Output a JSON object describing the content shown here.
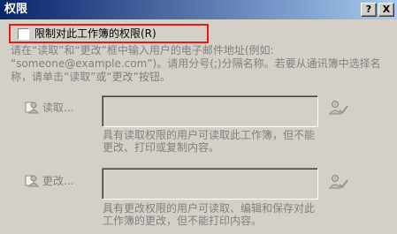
{
  "window": {
    "title": "权限",
    "help_label": "?",
    "close_label": "X"
  },
  "restrict": {
    "checkbox_label": "限制对此工作簿的权限(R)",
    "checked": false
  },
  "instructions": {
    "lines": [
      "请在“读取”和“更改”框中输入用户的电子邮件地址(例如:",
      "“someone@example.com”)。请用分号(;)分隔名称。若要从通讯簿中选择名",
      "称，请单击“读取”或“更改”按钮。"
    ]
  },
  "read": {
    "button_label": "读取...",
    "input_value": "",
    "description_lines": [
      "具有读取权限的用户可读取此工作簿，但不能",
      "更改、打印或复制内容。"
    ],
    "check_icon": "check-names-icon"
  },
  "change": {
    "button_label": "更改...",
    "input_value": "",
    "description_lines": [
      "具有更改权限的用户可读取、编辑和保存对此",
      "工作簿的更改，但不能打印内容。"
    ],
    "check_icon": "check-names-icon"
  },
  "colors": {
    "title_gradient_start": "#0a246a",
    "title_gradient_end": "#a6caf0",
    "highlight_border": "#e8171c",
    "dialog_face": "#d4d0c8",
    "disabled_text": "#808080"
  }
}
